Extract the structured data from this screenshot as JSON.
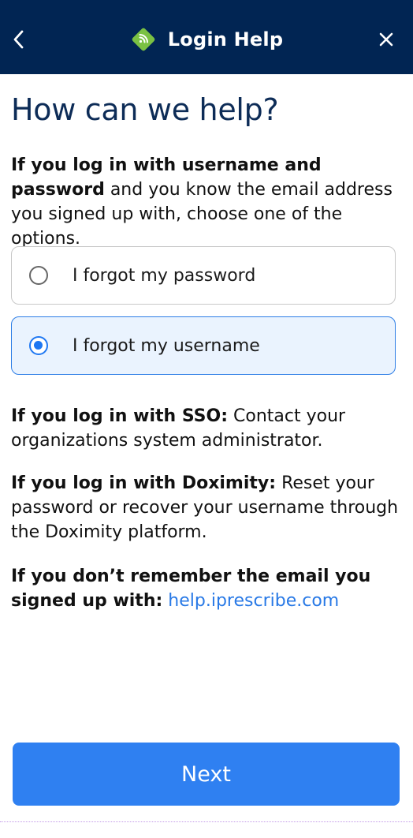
{
  "header": {
    "title": "Login Help",
    "logo_icon": "ip-logo-icon",
    "back_icon": "chevron-left-icon",
    "close_icon": "close-icon",
    "background": "#012553",
    "logo_color": "#7ac143"
  },
  "main": {
    "title": "How can we help?",
    "intro_bold": "If you log in with username and password",
    "intro_rest": "and you know the email address you signed up with, choose one of the options.",
    "options": [
      {
        "label": "I forgot my password",
        "selected": false
      },
      {
        "label": "I forgot my username",
        "selected": true
      }
    ],
    "sso_bold": "If you log in with SSO:",
    "sso_text": "Contact your organizations system administrator.",
    "doximity_bold": "If you log in with Doximity:",
    "doximity_text": "Reset your password or recover your username through the Doximity platform.",
    "email_bold": "If you don’t remember the email you signed up with:",
    "email_link": "help.iprescribe.com"
  },
  "footer": {
    "next_label": "Next",
    "accent": "#2f80f1"
  }
}
